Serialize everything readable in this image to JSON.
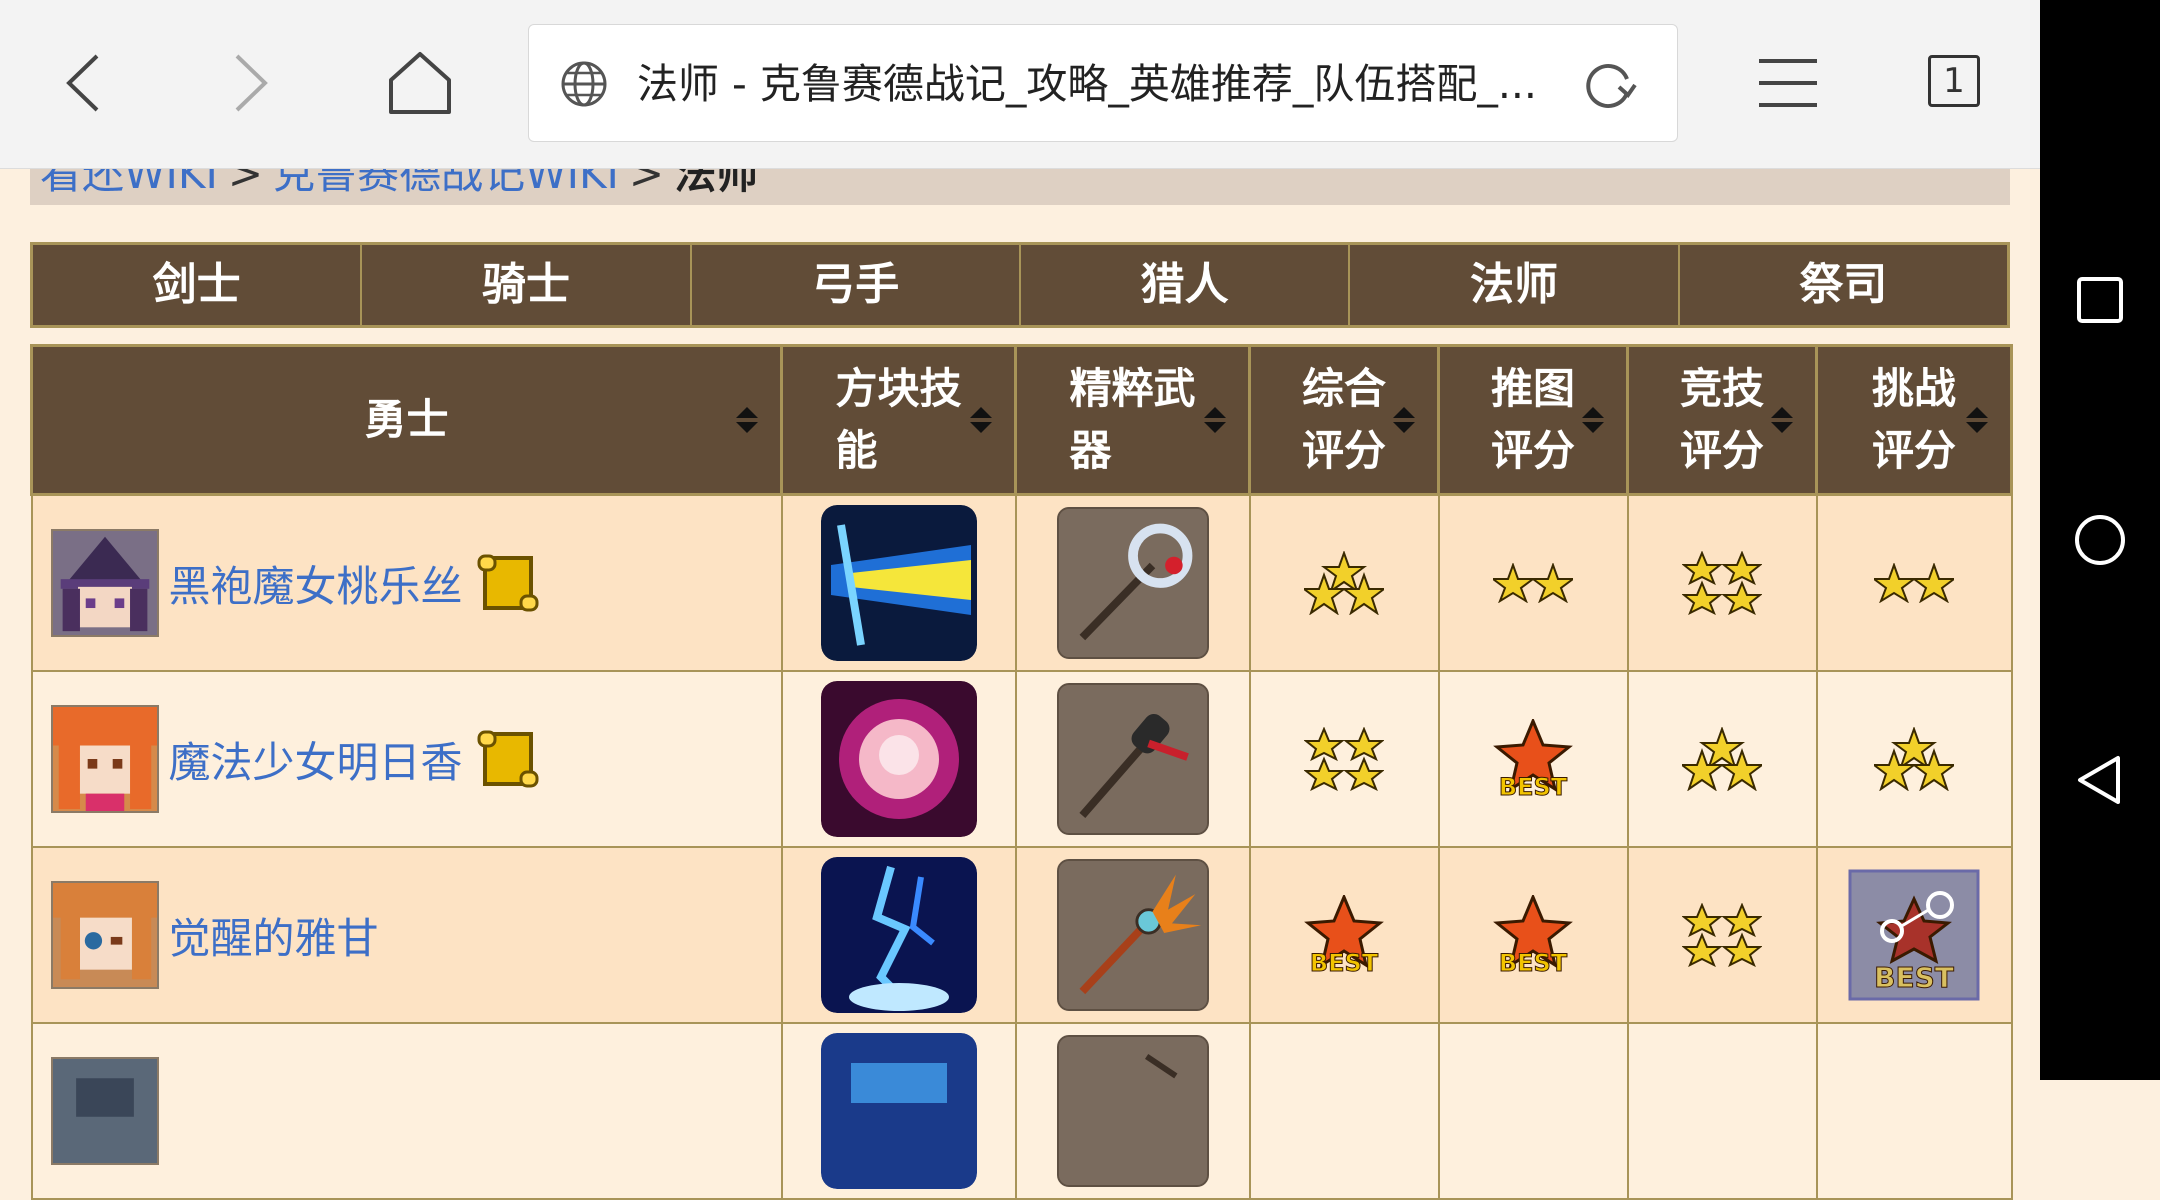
{
  "browser": {
    "url_title": "法师 - 克鲁赛德战记_攻略_英雄推荐_队伍搭配_...",
    "tab_count": "1"
  },
  "breadcrumb": {
    "items": [
      "看还WIKI",
      "克鲁赛德战记WIKI"
    ],
    "separator": ">",
    "current": "法师"
  },
  "class_tabs": [
    "剑士",
    "骑士",
    "弓手",
    "猎人",
    "法师",
    "祭司"
  ],
  "table": {
    "headers": {
      "hero": "勇士",
      "skill": [
        "方块技",
        "能"
      ],
      "weapon": [
        "精粹武",
        "器"
      ],
      "overall": [
        "综合",
        "评分"
      ],
      "push": [
        "推图",
        "评分"
      ],
      "arena": [
        "竞技",
        "评分"
      ],
      "challenge": [
        "挑战",
        "评分"
      ]
    },
    "rows": [
      {
        "name": "黑袍魔女桃乐丝",
        "has_scroll": true,
        "ratings": [
          "3 stars",
          "2 stars",
          "4 stars",
          "2 stars"
        ]
      },
      {
        "name": "魔法少女明日香",
        "has_scroll": true,
        "ratings": [
          "4 stars",
          "BEST",
          "3 stars",
          "3 stars"
        ]
      },
      {
        "name": "觉醒的雅甘",
        "has_scroll": false,
        "ratings": [
          "BEST",
          "BEST",
          "4 stars",
          "BEST"
        ]
      }
    ],
    "best_label": "BEST"
  },
  "colors": {
    "header_bg": "#614c37",
    "border": "#a89458",
    "link": "#3d6fc7",
    "row_odd": "#fde3c4",
    "row_even": "#fef0dd"
  }
}
